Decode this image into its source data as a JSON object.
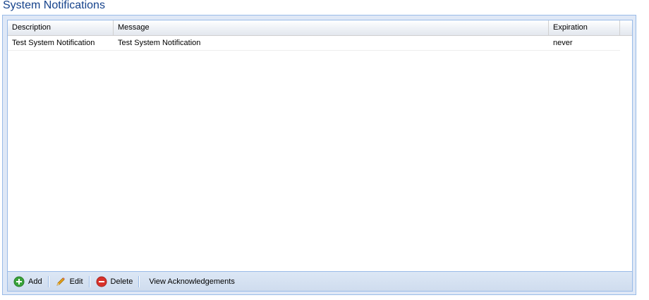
{
  "page": {
    "title": "System Notifications",
    "corner_mark": "´"
  },
  "grid": {
    "columns": [
      "Description",
      "Message",
      "Expiration"
    ],
    "rows": [
      {
        "description": "Test System Notification",
        "message": "Test System Notification",
        "expiration": "never"
      }
    ]
  },
  "toolbar": {
    "add_label": "Add",
    "edit_label": "Edit",
    "delete_label": "Delete",
    "view_ack_label": "View Acknowledgements"
  },
  "icons": {
    "add": "add-circle-icon",
    "edit": "pencil-icon",
    "delete": "delete-circle-icon"
  },
  "colors": {
    "title": "#15428b",
    "border": "#99bbe8",
    "add_green": "#3aa33a",
    "delete_red": "#d9322b",
    "pencil": "#e8a317"
  }
}
